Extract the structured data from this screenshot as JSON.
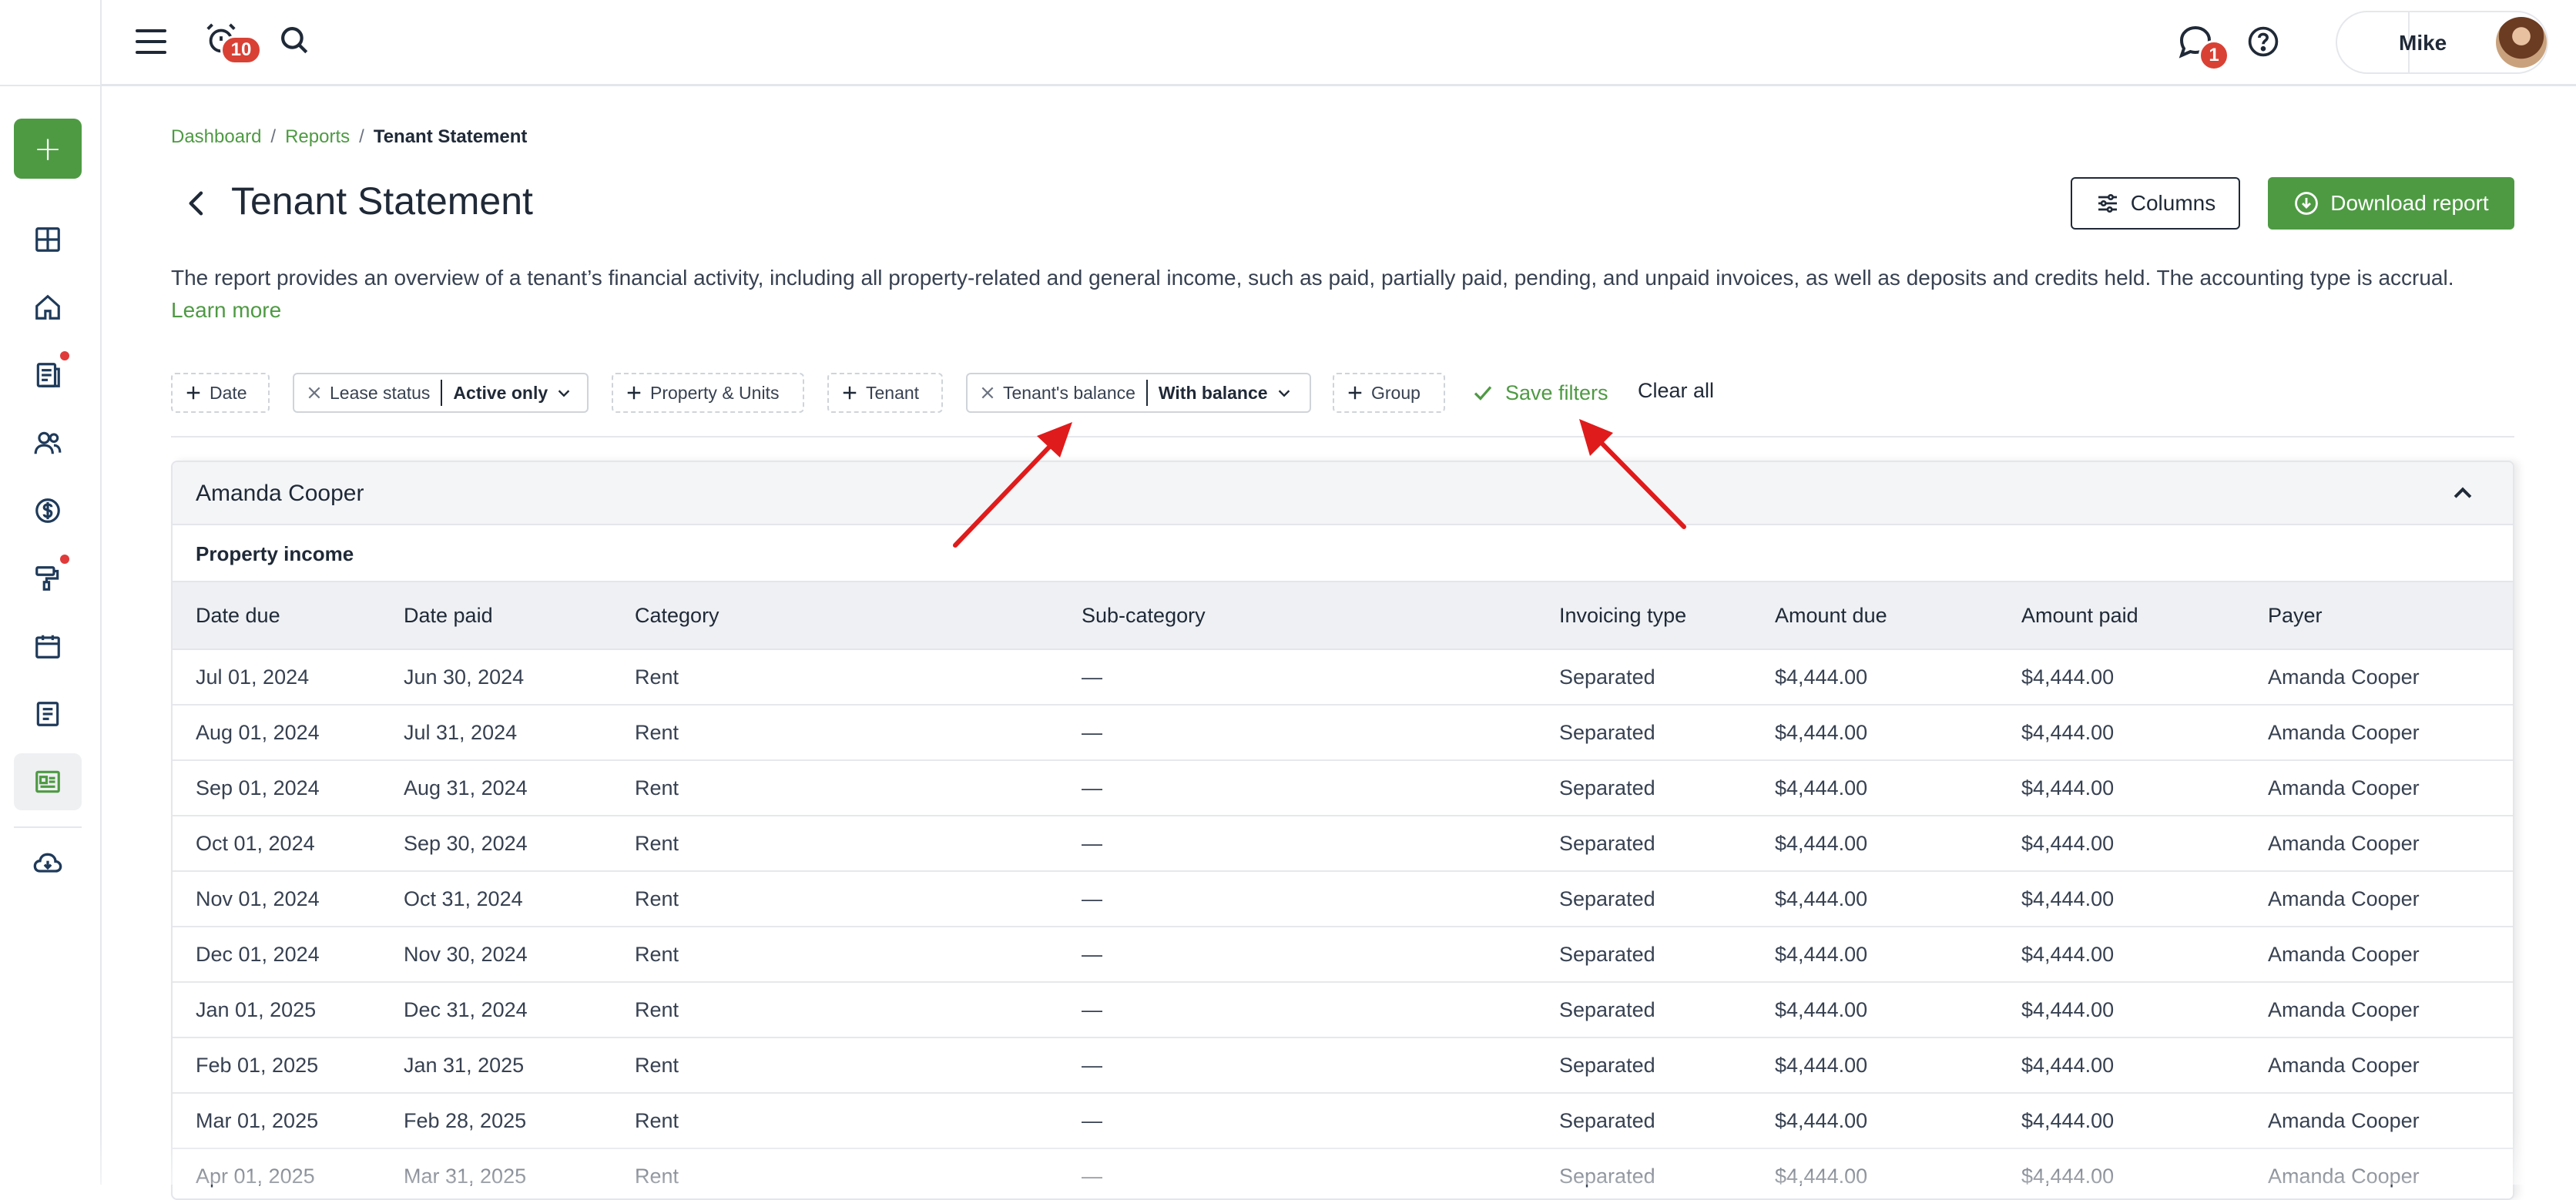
{
  "sidebar": {
    "add_label": "+",
    "items": [
      {
        "icon": "dashboard-icon"
      },
      {
        "icon": "home-icon"
      },
      {
        "icon": "leases-icon",
        "dot": true
      },
      {
        "icon": "people-icon"
      },
      {
        "icon": "dollar-icon"
      },
      {
        "icon": "maintenance-icon",
        "dot": true
      },
      {
        "icon": "calendar-icon"
      },
      {
        "icon": "documents-icon"
      },
      {
        "icon": "reports-icon",
        "active": true
      },
      {
        "icon": "cloud-download-icon"
      }
    ]
  },
  "topbar": {
    "alarm_badge": "10",
    "messages_badge": "1",
    "user_name": "Mike"
  },
  "breadcrumb": {
    "items": [
      "Dashboard",
      "Reports"
    ],
    "current": "Tenant Statement"
  },
  "page": {
    "title": "Tenant Statement",
    "columns_label": "Columns",
    "download_label": "Download report",
    "description": "The report provides an overview of a tenant’s financial activity, including all property-related and general income, such as paid, partially paid, pending, and unpaid invoices, as well as deposits and credits held. The accounting type is accrual.",
    "learn_more": "Learn more"
  },
  "filters": {
    "date": "Date",
    "lease_status_label": "Lease status",
    "lease_status_value": "Active only",
    "property_units": "Property & Units",
    "tenant": "Tenant",
    "balance_label": "Tenant's balance",
    "balance_value": "With balance",
    "group": "Group",
    "save_filters": "Save filters",
    "clear_all": "Clear all"
  },
  "report": {
    "tenant_name": "Amanda Cooper",
    "section": "Property income",
    "columns": [
      "Date due",
      "Date paid",
      "Category",
      "Sub-category",
      "Invoicing type",
      "Amount due",
      "Amount paid",
      "Payer"
    ],
    "rows": [
      [
        "Jul 01, 2024",
        "Jun 30, 2024",
        "Rent",
        "—",
        "Separated",
        "$4,444.00",
        "$4,444.00",
        "Amanda Cooper"
      ],
      [
        "Aug 01, 2024",
        "Jul 31, 2024",
        "Rent",
        "—",
        "Separated",
        "$4,444.00",
        "$4,444.00",
        "Amanda Cooper"
      ],
      [
        "Sep 01, 2024",
        "Aug 31, 2024",
        "Rent",
        "—",
        "Separated",
        "$4,444.00",
        "$4,444.00",
        "Amanda Cooper"
      ],
      [
        "Oct 01, 2024",
        "Sep 30, 2024",
        "Rent",
        "—",
        "Separated",
        "$4,444.00",
        "$4,444.00",
        "Amanda Cooper"
      ],
      [
        "Nov 01, 2024",
        "Oct 31, 2024",
        "Rent",
        "—",
        "Separated",
        "$4,444.00",
        "$4,444.00",
        "Amanda Cooper"
      ],
      [
        "Dec 01, 2024",
        "Nov 30, 2024",
        "Rent",
        "—",
        "Separated",
        "$4,444.00",
        "$4,444.00",
        "Amanda Cooper"
      ],
      [
        "Jan 01, 2025",
        "Dec 31, 2024",
        "Rent",
        "—",
        "Separated",
        "$4,444.00",
        "$4,444.00",
        "Amanda Cooper"
      ],
      [
        "Feb 01, 2025",
        "Jan 31, 2025",
        "Rent",
        "—",
        "Separated",
        "$4,444.00",
        "$4,444.00",
        "Amanda Cooper"
      ],
      [
        "Mar 01, 2025",
        "Feb 28, 2025",
        "Rent",
        "—",
        "Separated",
        "$4,444.00",
        "$4,444.00",
        "Amanda Cooper"
      ],
      [
        "Apr 01, 2025",
        "Mar 31, 2025",
        "Rent",
        "—",
        "Separated",
        "$4,444.00",
        "$4,444.00",
        "Amanda Cooper"
      ]
    ]
  },
  "colors": {
    "accent": "#4e9a43",
    "badge": "#d94135",
    "annotation_arrow": "#e01b1b"
  }
}
